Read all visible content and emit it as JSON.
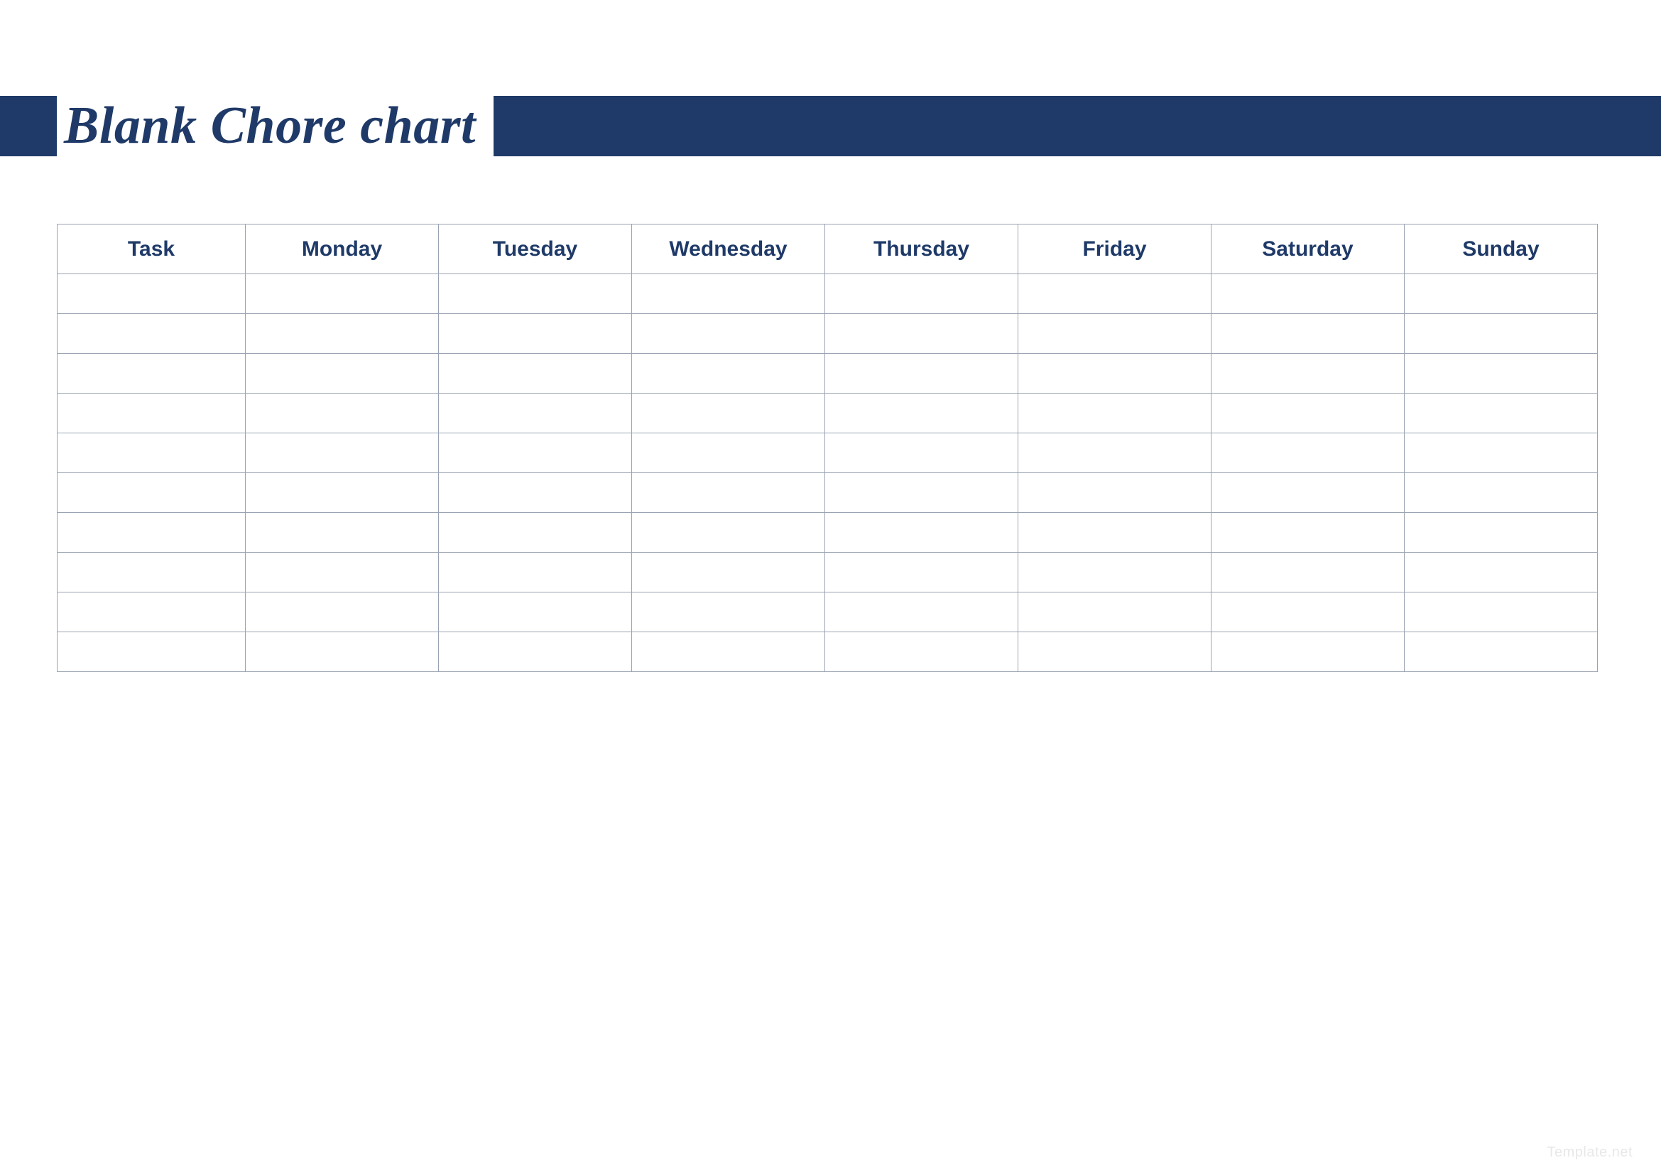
{
  "colors": {
    "brand_navy": "#1f3a68",
    "border_gray": "#9aa3b2"
  },
  "header": {
    "title": "Blank Chore chart"
  },
  "table": {
    "columns": [
      "Task",
      "Monday",
      "Tuesday",
      "Wednesday",
      "Thursday",
      "Friday",
      "Saturday",
      "Sunday"
    ],
    "blank_row_count": 10
  },
  "watermark": "Template.net"
}
